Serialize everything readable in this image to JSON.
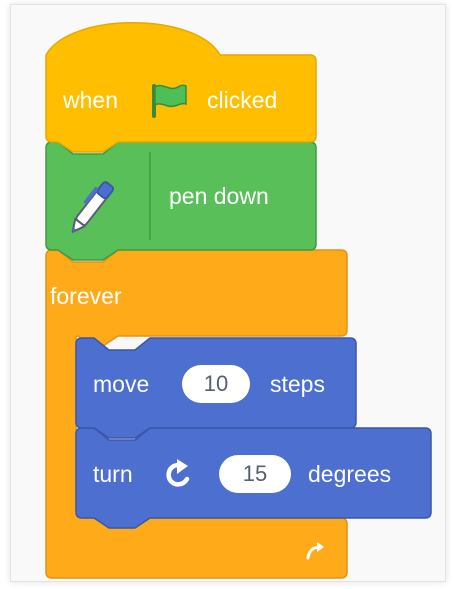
{
  "colors": {
    "events": "#ffbf00",
    "events_border": "#e6a800",
    "pen": "#59c059",
    "pen_border": "#3f9a3f",
    "control": "#ffab19",
    "control_border": "#e09316",
    "motion": "#4c6fd0",
    "motion_border": "#3a57a8",
    "oval_text": "#575e75"
  },
  "hat_block": {
    "word_before": "when",
    "icon": "green-flag-icon",
    "word_after": "clicked"
  },
  "pen_block": {
    "icon": "pen-icon",
    "label": "pen down"
  },
  "forever_block": {
    "label": "forever",
    "icon": "loop-arrow-icon"
  },
  "move_block": {
    "label_before": "move",
    "value": "10",
    "label_after": "steps"
  },
  "turn_block": {
    "label_before": "turn",
    "icon": "rotate-clockwise-icon",
    "value": "15",
    "label_after": "degrees"
  }
}
